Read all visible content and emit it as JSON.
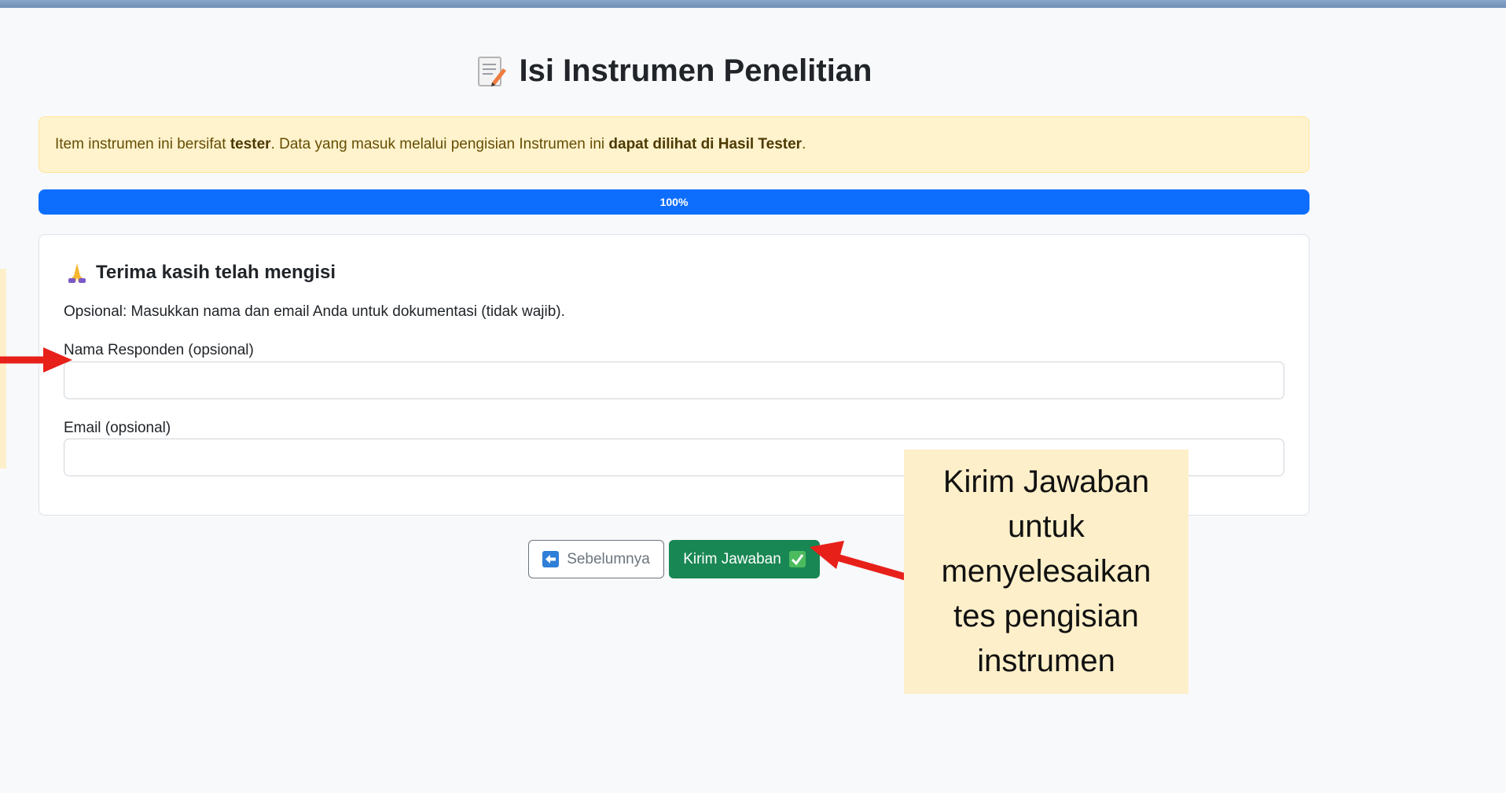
{
  "header": {
    "title": "Isi Instrumen Penelitian",
    "title_icon": "memo-icon"
  },
  "alert": {
    "text_1": "Item instrumen ini bersifat ",
    "bold_1": "tester",
    "text_2": ". Data yang masuk melalui pengisian Instrumen ini ",
    "bold_2": "dapat dilihat di Hasil Tester",
    "text_3": "."
  },
  "progress": {
    "label": "100%",
    "value": 100
  },
  "card": {
    "icon": "folded-hands-icon",
    "title": "Terima kasih telah mengisi",
    "subtitle": "Opsional: Masukkan nama dan email Anda untuk dokumentasi (tidak wajib).",
    "name_label": "Nama Responden (opsional)",
    "name_value": "",
    "email_label": "Email (opsional)",
    "email_value": ""
  },
  "buttons": {
    "prev_label": "Sebelumnya",
    "submit_label": "Kirim Jawaban"
  },
  "callout": {
    "text": "Kirim Jawaban untuk menyelesaikan tes pengisian instrumen"
  },
  "colors": {
    "primary": "#0d6efd",
    "success": "#198754",
    "warning_bg": "#fff3cd",
    "callout_bg": "#fdefc9",
    "arrow": "#e8201a"
  }
}
